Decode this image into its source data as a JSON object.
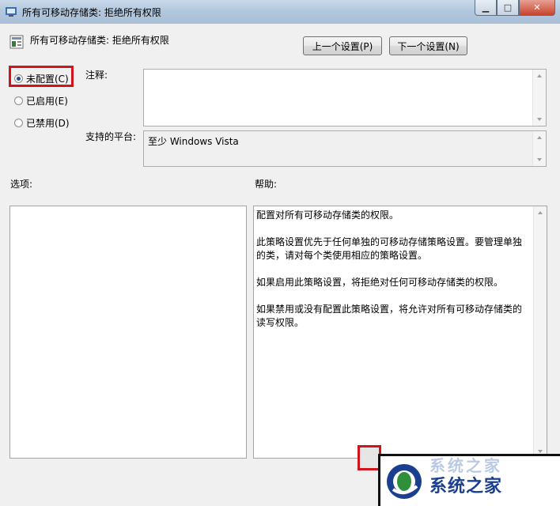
{
  "window": {
    "title": "所有可移动存储类: 拒绝所有权限",
    "min_glyph": "▁",
    "max_glyph": "□",
    "close_glyph": "✕"
  },
  "header": {
    "title": "所有可移动存储类: 拒绝所有权限",
    "prev_label": "上一个设置(P)",
    "next_label": "下一个设置(N)"
  },
  "state": {
    "options": [
      {
        "label": "未配置(C)",
        "checked": true
      },
      {
        "label": "已启用(E)",
        "checked": false
      },
      {
        "label": "已禁用(D)",
        "checked": false
      }
    ]
  },
  "comment": {
    "label": "注释:",
    "value": ""
  },
  "platform": {
    "label": "支持的平台:",
    "value": "至少 Windows Vista"
  },
  "options_panel": {
    "label": "选项:"
  },
  "help": {
    "label": "帮助:",
    "paragraphs": [
      "配置对所有可移动存储类的权限。",
      "此策略设置优先于任何单独的可移动存储策略设置。要管理单独的类，请对每个类使用相应的策略设置。",
      "如果启用此策略设置，将拒绝对任何可移动存储类的权限。",
      "如果禁用或没有配置此策略设置，将允许对所有可移动存储类的读写权限。"
    ]
  },
  "watermark": {
    "text": "系统之家",
    "faded_text": "系统之家"
  },
  "colors": {
    "highlight_border": "#d0141b",
    "title_bar": "#b3c8de"
  }
}
